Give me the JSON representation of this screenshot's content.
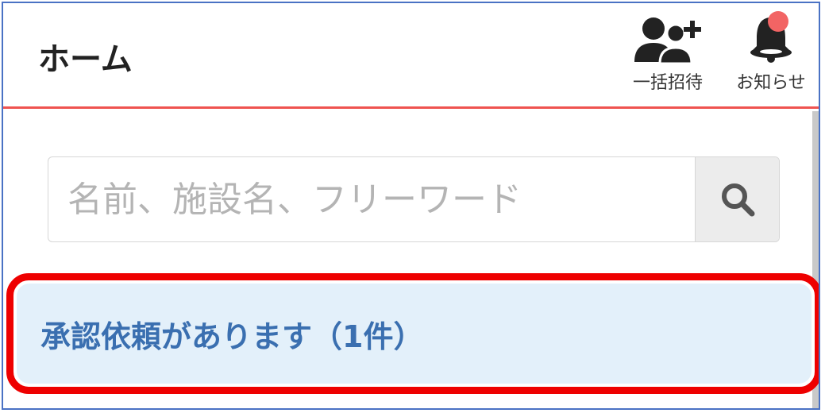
{
  "header": {
    "title": "ホーム",
    "invite_label": "一括招待",
    "notifications_label": "お知らせ",
    "badge_color": "#f26464",
    "accent_color": "#ef5350"
  },
  "search": {
    "placeholder": "名前、施設名、フリーワード",
    "value": "",
    "button_icon": "search-icon"
  },
  "alert": {
    "text": "承認依頼があります（1件）",
    "background_color": "#e3f0fa",
    "highlight_color": "#ee0000"
  }
}
